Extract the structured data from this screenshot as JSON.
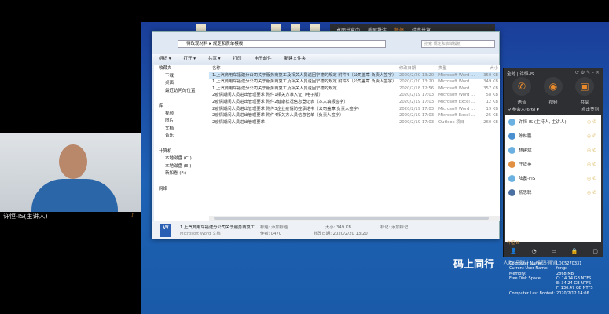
{
  "presenter": {
    "name": "许恒-IS(主讲人)",
    "mic_icon": "speaker-icon"
  },
  "share_bar": {
    "status": "桌面共享中",
    "annotate": "截屏批注",
    "pause": "暂停",
    "stop": "结束共享"
  },
  "explorer": {
    "path": [
      "待改现材料",
      "规定和表单模板"
    ],
    "search_placeholder": "搜索 规定和表单模板",
    "toolbar": [
      "组织 ▾",
      "打开 ▾",
      "共享 ▾",
      "打印",
      "电子邮件",
      "新建文件夹"
    ],
    "nav": [
      {
        "label": "收藏夹",
        "h": true
      },
      {
        "label": "下载"
      },
      {
        "label": "桌面"
      },
      {
        "label": "最近访问的位置"
      },
      {
        "label": "",
        "h": true
      },
      {
        "label": "库",
        "h": true
      },
      {
        "label": "视频"
      },
      {
        "label": "图片"
      },
      {
        "label": "文档"
      },
      {
        "label": "音乐"
      },
      {
        "label": "",
        "h": true
      },
      {
        "label": "计算机",
        "h": true
      },
      {
        "label": "本地磁盘 (C:)"
      },
      {
        "label": "本地磁盘 (E:)"
      },
      {
        "label": "新加卷 (F:)"
      },
      {
        "label": "",
        "h": true
      },
      {
        "label": "网络",
        "h": true
      }
    ],
    "columns": [
      "名称",
      "修改日期",
      "类型",
      "大小"
    ],
    "files": [
      {
        "name": "1.上汽商用车福建分公司关于服务商复工及相关人员返回宁德的规定 附件4（公司盖章 负责人签字）",
        "date": "2020/2/20 13:20",
        "type": "Microsoft Word ...",
        "size": "350 KB",
        "selected": true
      },
      {
        "name": "1.上汽商用车福建分公司关于服务商复工及相关人员返回宁德的规定 附件5（公司盖章 负责人签字）",
        "date": "2020/2/20 13:20",
        "type": "Microsoft Word ...",
        "size": "349 KB"
      },
      {
        "name": "1.上汽商用车福建分公司关于服务商复工及相关人员返回宁德的规定",
        "date": "2020/2/18 12:56",
        "type": "Microsoft Word ...",
        "size": "357 KB"
      },
      {
        "name": "2疫情期间人员进出管理要求 附件1相关方准入证（电子版）",
        "date": "2020/2/19 17:03",
        "type": "Microsoft Word ...",
        "size": "58 KB"
      },
      {
        "name": "2疫情期间人员进出管理要求 附件2健康状况信息登记表（本人填报签字）",
        "date": "2020/2/19 17:03",
        "type": "Microsoft Excel ...",
        "size": "12 KB"
      },
      {
        "name": "2疫情期间人员进出管理要求 附件3企业疫情防控承诺书（公司盖章 负责人签字）",
        "date": "2020/2/19 17:03",
        "type": "Microsoft Word ...",
        "size": "19 KB"
      },
      {
        "name": "2疫情期间人员进出管理要求 附件4相关方人员信息名单（负责人签字）",
        "date": "2020/2/19 17:03",
        "type": "Microsoft Excel ...",
        "size": "25 KB"
      },
      {
        "name": "2疫情期间人员进出管理要求",
        "date": "2020/2/19 17:03",
        "type": "Outlook 项目",
        "size": "260 KB"
      }
    ],
    "details": {
      "name": "1.上汽商用车福建分公司关于服务商复工...",
      "kind": "Microsoft Word 文档",
      "title": "标题: 添加标题",
      "author": "作者: L470",
      "size": "大小: 349 KB",
      "modified": "修改日期: 2020/2/20 13:20",
      "tags": "标记: 添加标记"
    }
  },
  "meeting": {
    "header": "全时 | 许恒-IS",
    "actions": [
      "语音",
      "视频",
      "共享"
    ],
    "participants_label": "参会人(6/6) ▾",
    "sign_in": "点击签到",
    "participants": [
      {
        "name": "许恒-IS (主持人, 主讲人)",
        "color": "#6ab0e0"
      },
      {
        "name": "陈林鹏",
        "color": "#4a8fd0"
      },
      {
        "name": "林建斌",
        "color": "#6ab0e0"
      },
      {
        "name": "庄铁英",
        "color": "#e09040"
      },
      {
        "name": "陆磊-FIS",
        "color": "#6ab0e0"
      },
      {
        "name": "杨思聪",
        "color": "#4a6fa0"
      }
    ],
    "speaker": "许恒-IS"
  },
  "desktop": {
    "brand": "码上同行",
    "brand_sub": "人脸识别 | 二维码通道",
    "sysinfo": [
      [
        "Computer Name:",
        "LDC5270331"
      ],
      [
        "Current User Name:",
        "fengx"
      ],
      [
        "Memory:",
        "2868 MB"
      ],
      [
        "Free Disk Space:",
        "C: 14.74 GB NTFS"
      ],
      [
        "",
        "E: 34.24 GB NTFS"
      ],
      [
        "",
        "F: 130.47 GB NTFS"
      ],
      [
        "Computer Last Booted:",
        "2020/2/12 14:06"
      ]
    ]
  }
}
